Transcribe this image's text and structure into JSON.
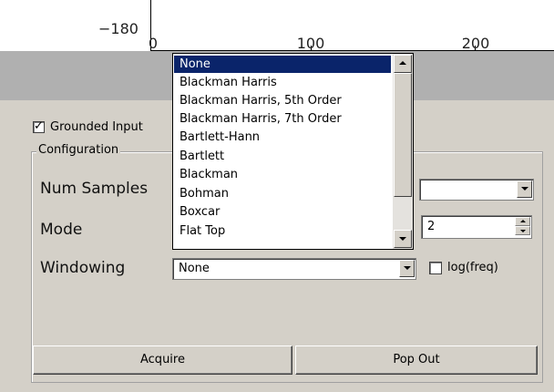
{
  "plot": {
    "y_tick_label": "−180",
    "x_tick_labels": [
      "0",
      "100",
      "200"
    ]
  },
  "grounded": {
    "label": "Grounded Input",
    "checked": true
  },
  "config": {
    "group_title": "Configuration",
    "num_samples_label": "Num Samples",
    "num_samples_value": "",
    "mode_label": "Mode",
    "mode_value": "2",
    "windowing_label": "Windowing",
    "windowing_value": "None",
    "logfreq_label": "log(freq)",
    "logfreq_checked": false
  },
  "buttons": {
    "acquire": "Acquire",
    "popout": "Pop Out"
  },
  "dropdown": {
    "options": [
      "None",
      "Blackman Harris",
      "Blackman Harris, 5th Order",
      "Blackman Harris, 7th Order",
      "Bartlett-Hann",
      "Bartlett",
      "Blackman",
      "Bohman",
      "Boxcar",
      "Flat Top"
    ],
    "selected_index": 0
  },
  "colors": {
    "window_bg": "#d4d0c8",
    "selection": "#0a246a",
    "plot_bg": "#b0b0b0"
  }
}
